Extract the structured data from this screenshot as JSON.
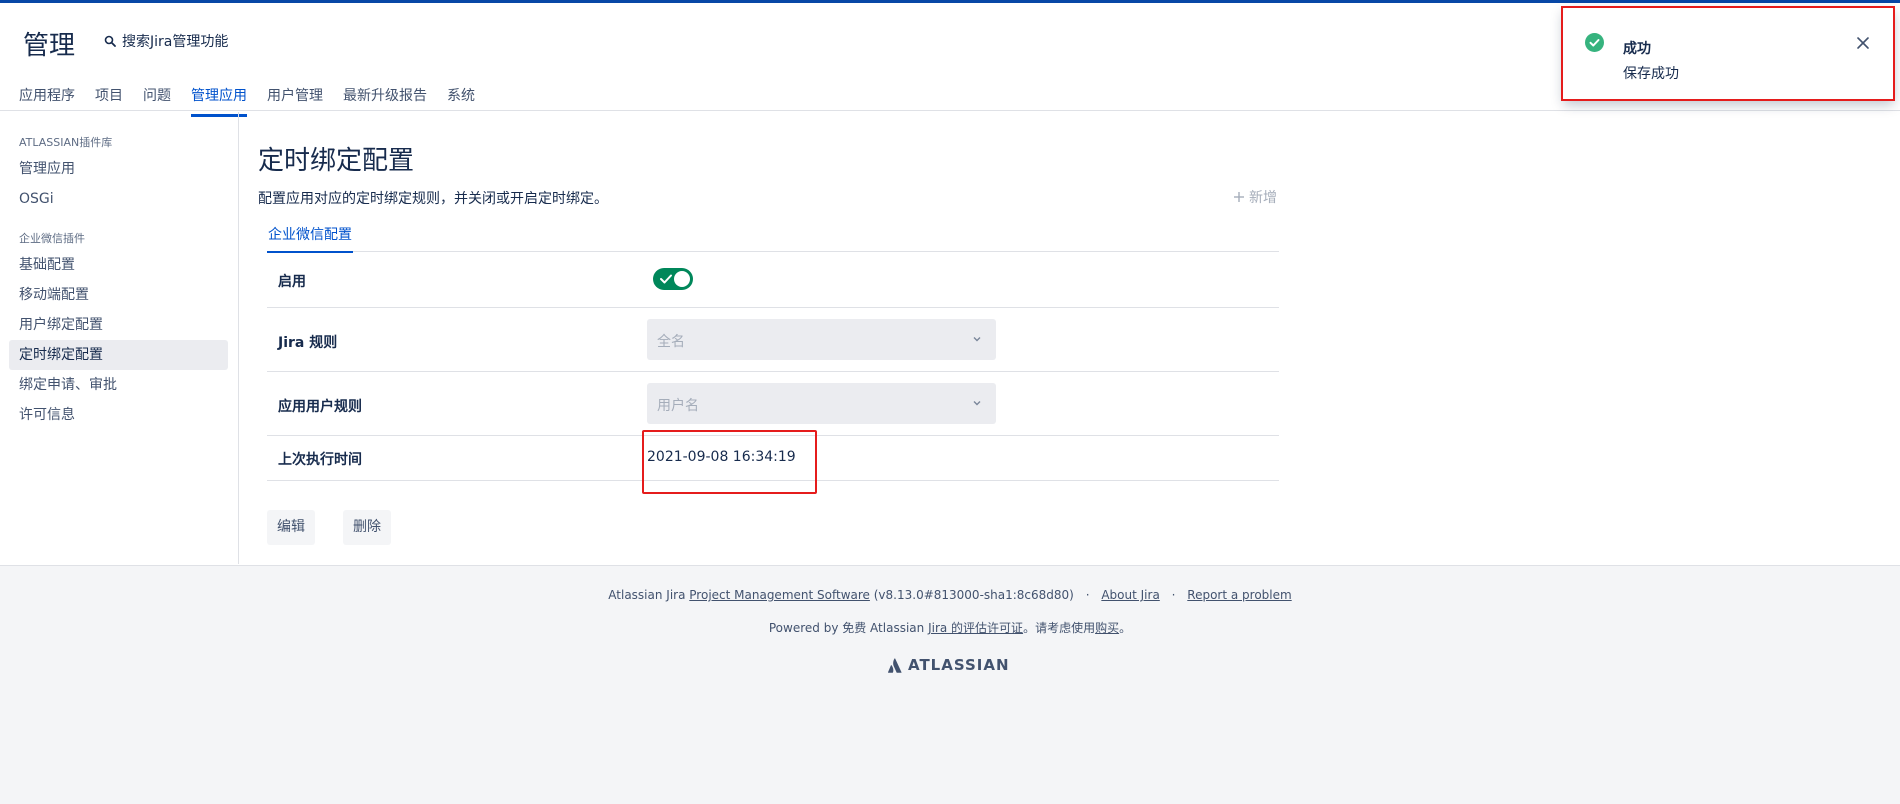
{
  "header": {
    "title": "管理",
    "search_label": "搜索Jira管理功能",
    "nav": [
      {
        "label": "应用程序",
        "active": false
      },
      {
        "label": "项目",
        "active": false
      },
      {
        "label": "问题",
        "active": false
      },
      {
        "label": "管理应用",
        "active": true
      },
      {
        "label": "用户管理",
        "active": false
      },
      {
        "label": "最新升级报告",
        "active": false
      },
      {
        "label": "系统",
        "active": false
      }
    ]
  },
  "sidebar": {
    "groups": [
      {
        "heading": "ATLASSIAN插件库",
        "items": [
          "管理应用",
          "OSGi"
        ]
      },
      {
        "heading": "企业微信插件",
        "items": [
          "基础配置",
          "移动端配置",
          "用户绑定配置",
          "定时绑定配置",
          "绑定申请、审批",
          "许可信息"
        ]
      }
    ],
    "active_item": "定时绑定配置"
  },
  "main": {
    "title": "定时绑定配置",
    "description": "配置应用对应的定时绑定规则，并关闭或开启定时绑定。",
    "add_label": "新增",
    "tab_label": "企业微信配置",
    "rows": {
      "enable_label": "启用",
      "enable_on": true,
      "jira_rule_label": "Jira 规则",
      "jira_rule_placeholder": "全名",
      "app_user_rule_label": "应用用户规则",
      "app_user_rule_placeholder": "用户名",
      "last_run_label": "上次执行时间",
      "last_run_value": "2021-09-08 16:34:19"
    },
    "edit_label": "编辑",
    "delete_label": "删除"
  },
  "footer": {
    "product_prefix": "Atlassian Jira",
    "product_link": "Project Management Software",
    "version": "(v8.13.0#813000-sha1:8c68d80)",
    "about_link": "About Jira",
    "report_link": "Report a problem",
    "powered_prefix": "Powered by 免费 Atlassian",
    "license_link": "Jira 的评估许可证",
    "purchase_prefix": "。请考虑使用",
    "purchase_link": "购买",
    "purchase_suffix": "。",
    "logo_text": "ATLASSIAN"
  },
  "flag": {
    "title": "成功",
    "body": "保存成功",
    "icon": "check-circle-icon"
  },
  "colors": {
    "brand_blue": "#0052cc",
    "toggle_green": "#00875a",
    "highlight_red": "#e51c1c",
    "success_green": "#36b37e"
  }
}
